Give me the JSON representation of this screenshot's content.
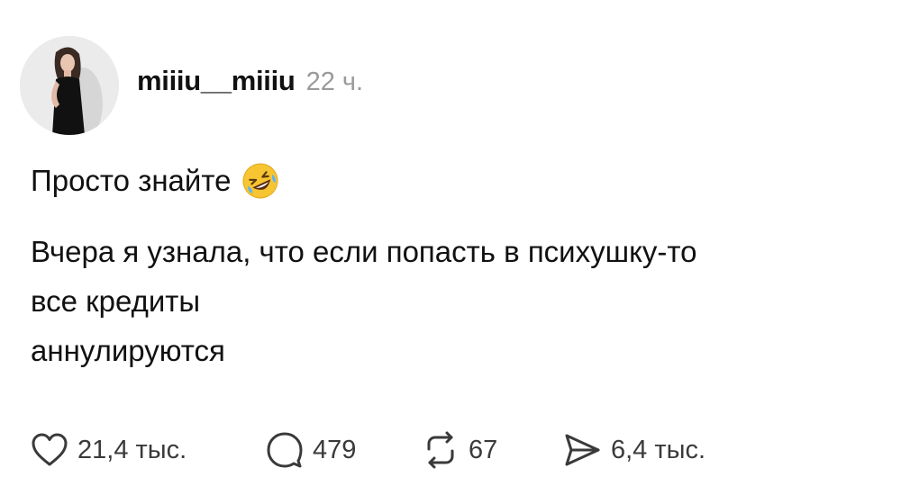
{
  "post": {
    "author": {
      "username": "miiiu__miiiu",
      "time_ago": "22 ч.",
      "avatar_icon": "profile-photo"
    },
    "text": {
      "line1": "Просто знайте",
      "line1_emoji": "rolling-on-floor-laughing-emoji",
      "line2": "Вчера я узнала, что если попасть в психушку-то",
      "line3": "все кредиты",
      "line4": "аннулируются"
    },
    "actions": {
      "likes": "21,4 тыс.",
      "replies": "479",
      "reposts": "67",
      "shares": "6,4 тыс."
    }
  },
  "colors": {
    "text": "#111111",
    "muted": "#9a9a9a",
    "icon": "#3a3a3a",
    "emoji_yellow": "#f7c531"
  }
}
